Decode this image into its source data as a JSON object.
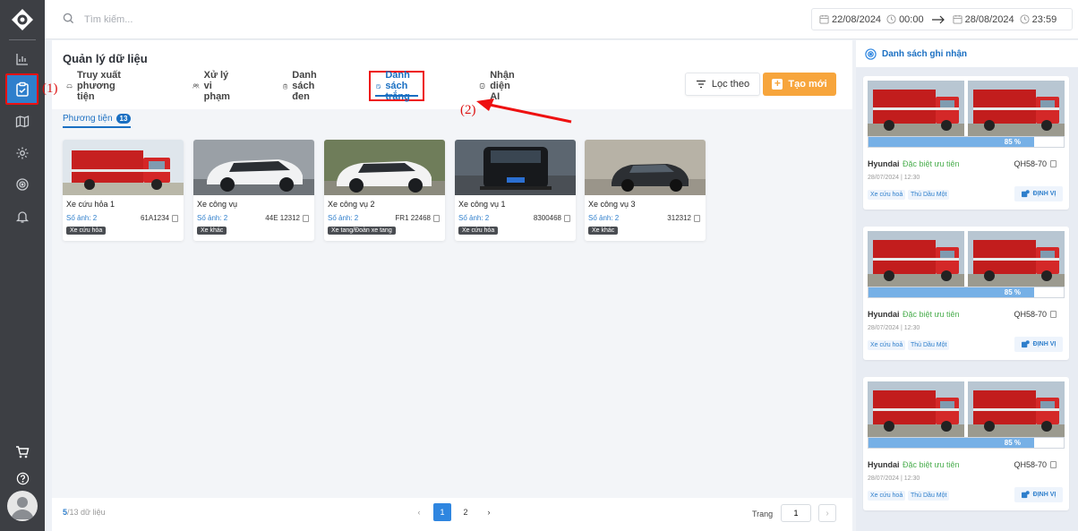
{
  "search": {
    "placeholder": "Tìm kiếm..."
  },
  "date_range": {
    "start_date": "22/08/2024",
    "start_time": "00:00",
    "end_date": "28/08/2024",
    "end_time": "23:59"
  },
  "page": {
    "title": "Quản lý dữ liệu"
  },
  "tabs": [
    {
      "label": "Truy xuất phương tiện"
    },
    {
      "label": "Xử lý vi phạm"
    },
    {
      "label": "Danh sách đen"
    },
    {
      "label": "Danh sách trắng"
    },
    {
      "label": "Nhận diện AI"
    }
  ],
  "toolbar": {
    "filter_label": "Lọc theo",
    "create_label": "Tạo mới"
  },
  "subtab": {
    "label": "Phương tiện",
    "count": "13"
  },
  "vehicles": [
    {
      "name": "Xe cứu hỏa 1",
      "images": "Số ảnh: 2",
      "plate": "61A1234",
      "tag": "Xe cứu hỏa",
      "kind": "firetruck"
    },
    {
      "name": "Xe công vụ",
      "images": "Số ảnh: 2",
      "plate": "44E 12312",
      "tag": "Xe khác",
      "kind": "white-suv"
    },
    {
      "name": "Xe công vụ 2",
      "images": "Số ảnh: 2",
      "plate": "FR1 22468",
      "tag": "Xe tang/Đoàn xe tang",
      "kind": "white-suv-2"
    },
    {
      "name": "Xe công vụ 1",
      "images": "Số ảnh: 2",
      "plate": "8300468",
      "tag": "Xe cứu hỏa",
      "kind": "black-suv"
    },
    {
      "name": "Xe công vụ 3",
      "images": "Số ảnh: 2",
      "plate": "312312",
      "tag": "Xe khác",
      "kind": "dark-suv"
    }
  ],
  "pagination": {
    "shown": "5",
    "total": "/13",
    "suffix": "dữ liệu",
    "pages": [
      "1",
      "2"
    ],
    "current": "1",
    "page_label": "Trang",
    "page_value": "1"
  },
  "right_panel": {
    "title": "Danh sách ghi nhận",
    "records": [
      {
        "confidence_percent": 85,
        "confidence_label": "85 %",
        "brand": "Hyundai",
        "type": "Đặc biệt ưu tiên",
        "plate": "QH58-70",
        "time": "28/07/2024 | 12:30",
        "tags": [
          "Xe cứu hoả",
          "Thủ Dầu Một"
        ],
        "action": "ĐỊNH VỊ"
      },
      {
        "confidence_percent": 85,
        "confidence_label": "85 %",
        "brand": "Hyundai",
        "type": "Đặc biệt ưu tiên",
        "plate": "QH58-70",
        "time": "28/07/2024 | 12:30",
        "tags": [
          "Xe cứu hoả",
          "Thủ Dầu Một"
        ],
        "action": "ĐỊNH VỊ"
      },
      {
        "confidence_percent": 85,
        "confidence_label": "85 %",
        "brand": "Hyundai",
        "type": "Đặc biệt ưu tiên",
        "plate": "QH58-70",
        "time": "28/07/2024 | 12:30",
        "tags": [
          "Xe cứu hoả",
          "Thủ Dầu Một"
        ],
        "action": "ĐỊNH VỊ"
      }
    ]
  },
  "annotations": {
    "step1": "(1)",
    "step2": "(2)"
  },
  "colors": {
    "accent": "#1a6fc2",
    "create": "#f7a53c",
    "sidebar": "#3d3f44",
    "highlight": "#e11111"
  }
}
